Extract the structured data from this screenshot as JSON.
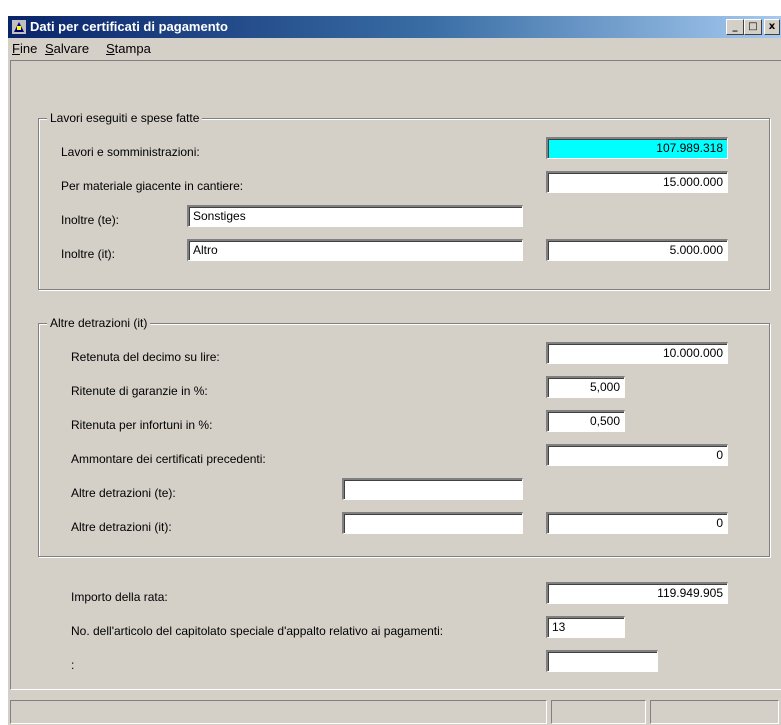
{
  "window": {
    "title": "Dati per certificati di pagamento",
    "minimize_glyph": "_",
    "restore_glyph": "□",
    "close_glyph": "x"
  },
  "menu": [
    {
      "first": "F",
      "rest": "ine"
    },
    {
      "first": "S",
      "rest": "alvare"
    },
    {
      "first": "",
      "underlined": "S",
      "tail": "tampa",
      "prefix": ""
    }
  ],
  "menu_labels": {
    "fine": "Fine",
    "salvare": "Salvare",
    "stampa": "Stampa"
  },
  "group1": {
    "title": "Lavori eseguiti e spese fatte",
    "lavori_label": "Lavori e somministrazioni:",
    "lavori_value": "107.989.318",
    "materiale_label": "Per materiale giacente in cantiere:",
    "materiale_value": "15.000.000",
    "inoltre_te_label": "Inoltre (te):",
    "inoltre_te_text": "Sonstiges",
    "inoltre_it_label": "Inoltre (it):",
    "inoltre_it_text": "Altro",
    "inoltre_it_value": "5.000.000"
  },
  "group2": {
    "title": "Altre detrazioni (it)",
    "decimo_label": "Retenuta del decimo su lire:",
    "decimo_value": "10.000.000",
    "garanzie_label": "Ritenute di garanzie in %:",
    "garanzie_value": "5,000",
    "infortuni_label": "Ritenuta per infortuni in %:",
    "infortuni_value": "0,500",
    "precedenti_label": "Ammontare dei certificati precedenti:",
    "precedenti_value": "0",
    "altre_te_label": "Altre detrazioni (te):",
    "altre_te_text": "",
    "altre_it_label": "Altre detrazioni (it):",
    "altre_it_text": "",
    "altre_it_value": "0"
  },
  "bottom": {
    "importo_label": "Importo della rata:",
    "importo_value": "119.949.905",
    "articolo_label": "No. dell'articolo del capitolato speciale d'appalto relativo ai pagamenti:",
    "articolo_value": "13",
    "colon_label": ":",
    "colon_value": ""
  },
  "colors": {
    "title_gradient_start": "#0a246a",
    "highlight_field": "#00ffff",
    "face": "#d4d0c8"
  },
  "icons": {
    "app": "app-icon",
    "minimize": "minimize-icon",
    "restore": "restore-icon",
    "close": "close-icon"
  }
}
